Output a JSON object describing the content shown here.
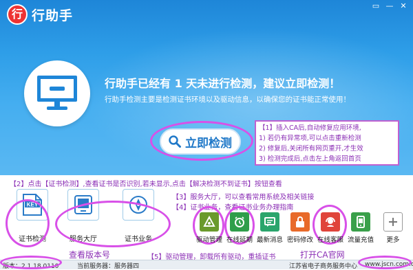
{
  "app": {
    "title": "行助手",
    "logo_char": "行"
  },
  "window": {
    "minimize": "—",
    "close": "✕",
    "skin": "▭"
  },
  "hero": {
    "headline": "行助手已经有 1 天未进行检测，建议立即检测！",
    "subline": "行助手检测主要是检测证书环境以及驱动信息，以确保您的证书能正常使用！",
    "check_button": "立即检测"
  },
  "callout": {
    "lines": [
      "【1】插入CA后,自动修复应用环境,",
      "1) 若仍有异常项,可以点击重新检测",
      "2) 修复后,关闭所有网页重开,才生效",
      "3) 检测完成后,点击左上角返回首页"
    ]
  },
  "annotations": {
    "a2": "【2】点击【证书检测】,查看证书是否识别,若未显示,点击【解决检测不到证书】按钮查看",
    "a3": "【3】服务大厅，可以查看常用系统及相关链接",
    "a4": "【4】证书业务，查看证书业务办理指南",
    "a5": "【5】驱动管理，卸载所有驱动，重插证书",
    "version_hint": "查看版本号",
    "ca_site": "打开CA官网"
  },
  "big_tools": [
    {
      "label": "证书检测"
    },
    {
      "label": "服务大厅"
    },
    {
      "label": "证书业务"
    }
  ],
  "small_tools": [
    {
      "label": "驱动管理",
      "color": "#6a9a2c"
    },
    {
      "label": "在线延期",
      "color": "#2f9e4a"
    },
    {
      "label": "最新消息",
      "color": "#2aa56c"
    },
    {
      "label": "密码修改",
      "color": "#e86a2a"
    },
    {
      "label": "在线客服",
      "color": "#e0443a"
    },
    {
      "label": "流量充值",
      "color": "#3aa04a"
    },
    {
      "label": "更多",
      "color": "#ffffff"
    }
  ],
  "status": {
    "version": "版本：2.1.18.0110",
    "server": "当前服务器：服务器四",
    "org": "江苏省电子商务服务中心",
    "site": "www.jscn.com.cn"
  },
  "colors": {
    "hero": "#2e9ee8",
    "annotation": "#d850e8",
    "accent": "#1f78c8"
  }
}
